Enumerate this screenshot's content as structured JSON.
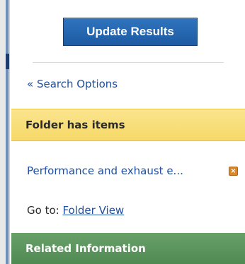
{
  "update_button": {
    "label": "Update Results"
  },
  "search_options": {
    "label": "« Search Options"
  },
  "folder": {
    "header": "Folder has items",
    "item_link": "Performance and exhaust e...",
    "remove_icon": "close-icon",
    "goto_label": "Go to:",
    "goto_link": "Folder View"
  },
  "related": {
    "header": "Related Information"
  },
  "colors": {
    "button_bg": "#1d5ba3",
    "link": "#1e4fa3",
    "folder_header_bg": "#f6d968",
    "related_header_bg": "#4f8a52",
    "remove_icon_bg": "#d8882a"
  }
}
